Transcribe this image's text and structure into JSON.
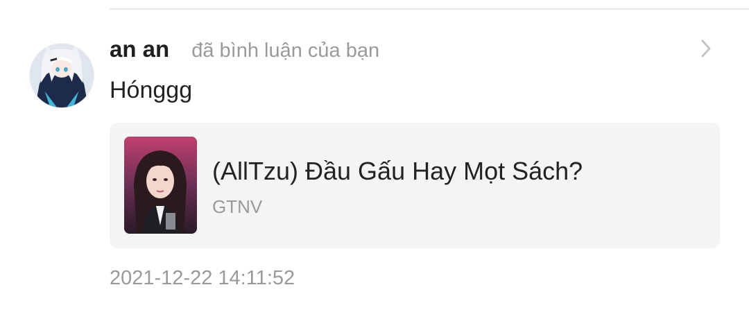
{
  "notification": {
    "user": {
      "name": "an an",
      "avatar_icon": "anime-avatar-icon"
    },
    "action": "đã bình luận của bạn",
    "comment": "Hónggg",
    "story": {
      "title": "(AllTzu) Đầu Gấu Hay Mọt Sách?",
      "author": "GTNV",
      "cover_icon": "story-cover-image"
    },
    "timestamp": "2021-12-22 14:11:52",
    "open_icon": "chevron-right-icon"
  },
  "colors": {
    "primary_text": "#222222",
    "secondary_text": "#9a9a9a",
    "card_background": "#f4f4f4",
    "divider": "#e6e6e6"
  }
}
